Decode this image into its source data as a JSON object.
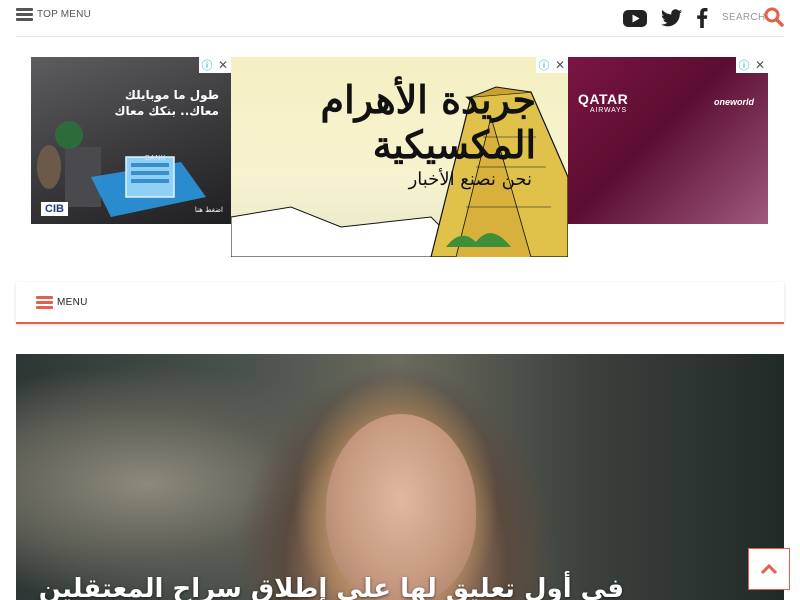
{
  "header": {
    "top_menu_label": "TOP MENU",
    "search_label": "SEARCH",
    "social_icons": [
      "youtube-icon",
      "twitter-icon",
      "facebook-icon"
    ],
    "icon_color": "#222222",
    "search_icon_color": "#e0614c"
  },
  "ads": {
    "left": {
      "text": "طول ما موبايلك معاك.. بنكك معاك",
      "cta": "اضغط هنا",
      "logo": "CIB",
      "sign": "BANK"
    },
    "center": {
      "title": "جريدة الأهرام المكسيكية",
      "subtitle": "نحن نصنع الأخبار"
    },
    "right": {
      "brand": "QATAR",
      "brand_sub": "AIRWAYS",
      "alliance": "oneworld"
    }
  },
  "menubar": {
    "menu_label": "MENU",
    "accent": "#e0614c"
  },
  "featured": {
    "headline": "في أول تعليق لها على إطلاق سراح المعتقلين"
  }
}
